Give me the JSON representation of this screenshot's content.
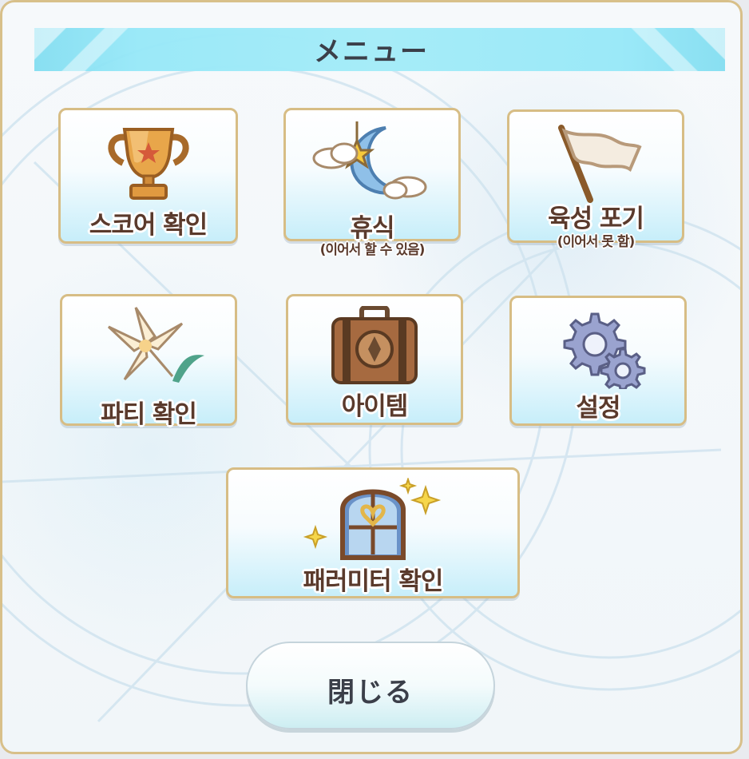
{
  "title": "メニュー",
  "menu": {
    "score": {
      "label": "스코어 확인",
      "icon": "trophy-icon"
    },
    "rest": {
      "label": "휴식",
      "sub": "(이어서 할 수 있음)",
      "icon": "moon-star-icon"
    },
    "give_up": {
      "label": "육성 포기",
      "sub": "(이어서 못 함)",
      "icon": "white-flag-icon"
    },
    "party": {
      "label": "파티 확인",
      "icon": "lily-icon"
    },
    "item": {
      "label": "아이템",
      "icon": "suitcase-icon"
    },
    "settings": {
      "label": "설정",
      "icon": "gears-icon"
    },
    "parameter": {
      "label": "패러미터 확인",
      "icon": "window-icon"
    }
  },
  "close_label": "閉じる",
  "colors": {
    "border_gold": "#d7bd85",
    "title_cyan": "#a6ecf8",
    "text_brown": "#5a3a2c",
    "text_dark": "#3b3f49"
  }
}
